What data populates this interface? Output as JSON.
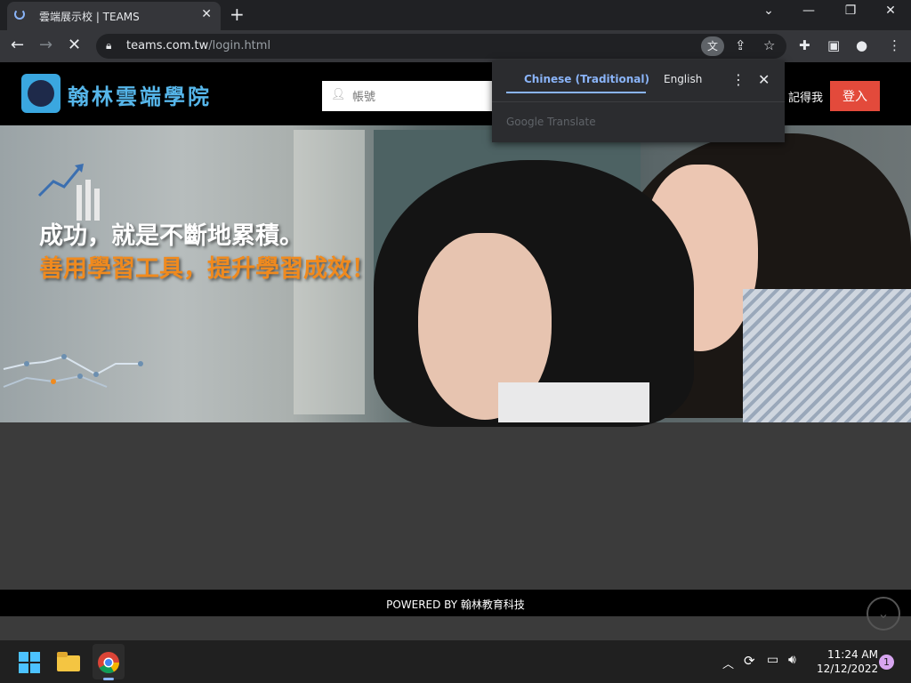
{
  "browser": {
    "tab_title": "雲端展示校 | TEAMS",
    "new_tab_symbol": "+",
    "close_tab_symbol": "✕",
    "url_domain": "teams.com.tw",
    "url_path": "/login.html"
  },
  "translate_popup": {
    "tab_source": "Chinese (Traditional)",
    "tab_target": "English",
    "brand": "Google Translate"
  },
  "header": {
    "logo_text": "翰林雲端學院",
    "account_placeholder": "帳號",
    "remember_label": "記得我",
    "login_label": "登入"
  },
  "hero": {
    "line1": "成功，就是不斷地累積。",
    "line2": "善用學習工具，提升學習成效！"
  },
  "footer": {
    "text": "POWERED BY 翰林教育科技"
  },
  "taskbar": {
    "time": "11:24 AM",
    "date": "12/12/2022",
    "notification_count": "1"
  },
  "colors": {
    "brand_blue": "#3aa7e0",
    "login_red": "#e34a3b",
    "hero_orange": "#f08a1e",
    "translate_accent": "#8ab4f8"
  }
}
